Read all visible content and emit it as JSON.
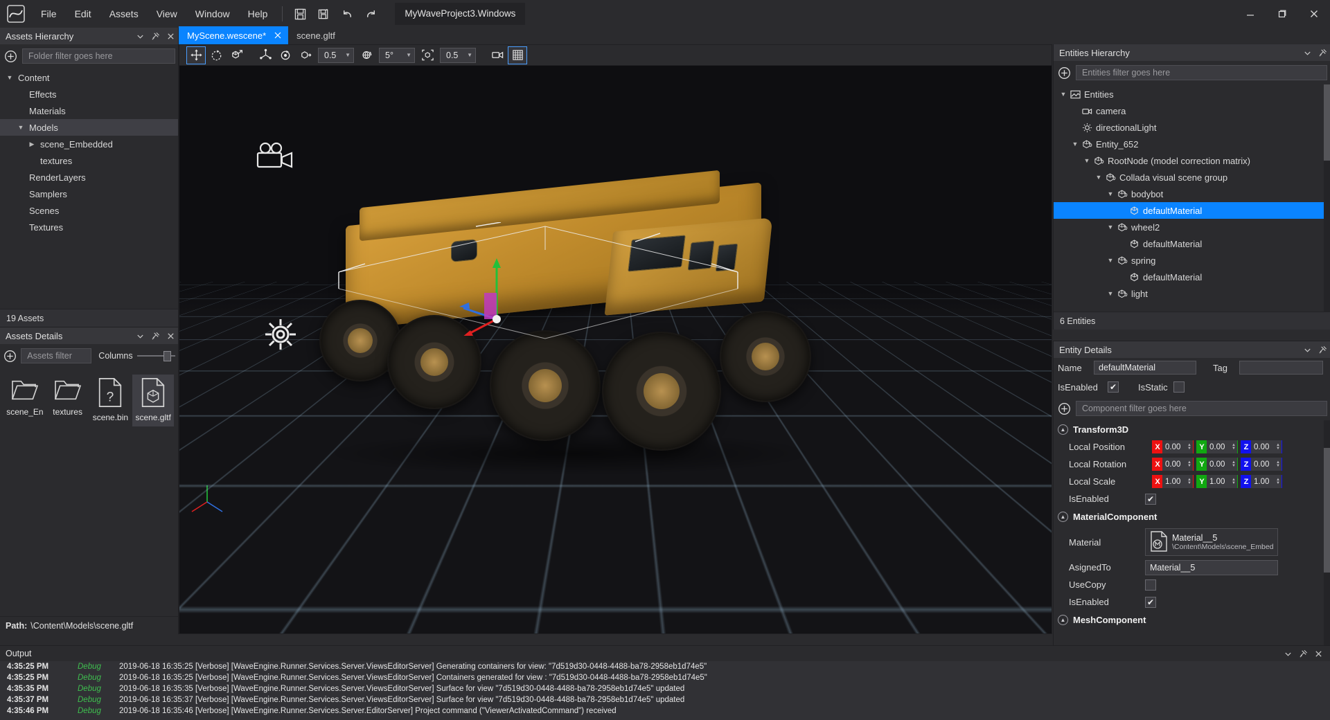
{
  "titlebar": {
    "logo_icon": "wave-engine-logo",
    "menus": [
      "File",
      "Edit",
      "Assets",
      "View",
      "Window",
      "Help"
    ],
    "icons": [
      {
        "name": "save-icon",
        "label": "Save"
      },
      {
        "name": "save-all-icon",
        "label": "Save All"
      },
      {
        "name": "undo-icon",
        "label": "Undo"
      },
      {
        "name": "redo-icon",
        "label": "Redo"
      }
    ],
    "project_name": "MyWaveProject3.Windows",
    "window_controls": [
      {
        "name": "minimize-button",
        "glyph": "—"
      },
      {
        "name": "maximize-button",
        "glyph": "❑"
      },
      {
        "name": "close-button",
        "glyph": "✕"
      }
    ]
  },
  "tabs": [
    {
      "label": "MyScene.wescene*",
      "active": true,
      "closable": true
    },
    {
      "label": "scene.gltf",
      "active": false,
      "closable": false
    }
  ],
  "assets_hierarchy": {
    "title": "Assets Hierarchy",
    "filter_placeholder": "Folder filter goes here",
    "add_icon": "plus-circle-icon",
    "header_icons": [
      "chevron-down-icon",
      "pin-icon",
      "close-icon"
    ],
    "tree": [
      {
        "label": "Content",
        "depth": 0,
        "caret": "down",
        "selected": false
      },
      {
        "label": "Effects",
        "depth": 1,
        "caret": "none",
        "selected": false
      },
      {
        "label": "Materials",
        "depth": 1,
        "caret": "none",
        "selected": false
      },
      {
        "label": "Models",
        "depth": 1,
        "caret": "down",
        "selected": true
      },
      {
        "label": "scene_Embedded",
        "depth": 2,
        "caret": "right",
        "selected": false
      },
      {
        "label": "textures",
        "depth": 2,
        "caret": "none",
        "selected": false
      },
      {
        "label": "RenderLayers",
        "depth": 1,
        "caret": "none",
        "selected": false
      },
      {
        "label": "Samplers",
        "depth": 1,
        "caret": "none",
        "selected": false
      },
      {
        "label": "Scenes",
        "depth": 1,
        "caret": "none",
        "selected": false
      },
      {
        "label": "Textures",
        "depth": 1,
        "caret": "none",
        "selected": false
      }
    ],
    "status": "19 Assets"
  },
  "assets_details": {
    "title": "Assets Details",
    "header_icons": [
      "chevron-down-icon",
      "pin-icon",
      "close-icon"
    ],
    "filter_placeholder": "Assets filter",
    "columns_label": "Columns",
    "add_icon": "plus-circle-icon",
    "assets": [
      {
        "name": "scene_En",
        "icon": "folder-icon",
        "selected": false
      },
      {
        "name": "textures",
        "icon": "folder-icon",
        "selected": false
      },
      {
        "name": "scene.bin",
        "icon": "unknown-file-icon",
        "selected": false
      },
      {
        "name": "scene.gltf",
        "icon": "model-file-icon",
        "selected": true
      }
    ],
    "path_label": "Path:",
    "path_value": "\\Content\\Models\\scene.gltf"
  },
  "viewport_toolbar": {
    "buttons": [
      {
        "name": "translate-tool-button",
        "icon": "move-arrows-icon",
        "active": true
      },
      {
        "name": "rotate-tool-button",
        "icon": "rotate-dashed-icon",
        "active": false
      },
      {
        "name": "scale-tool-button",
        "icon": "scale-cube-icon",
        "active": false
      },
      {
        "name": "snap-translate-button",
        "icon": "snap-axes-icon",
        "active": false
      },
      {
        "name": "snap-rotate-button",
        "icon": "snap-rotate-icon",
        "active": false
      },
      {
        "name": "snap-scale-button",
        "icon": "snap-scale-icon",
        "active": false
      }
    ],
    "translate_snap": "0.5",
    "rotate_snap_icon": "globe-rotate-icon",
    "rotate_snap": "5°",
    "scale_snap_icon": "bounds-scale-icon",
    "scale_snap": "0.5",
    "camera_button": {
      "name": "camera-preview-button",
      "icon": "video-camera-icon",
      "active": false
    },
    "grid_button": {
      "name": "grid-toggle-button",
      "icon": "grid-icon",
      "active": true
    }
  },
  "viewport": {
    "camera_gizmo_icon": "scene-camera-icon",
    "gear_gizmo_icon": "gear-icon",
    "transform_gizmo": "translate-gizmo",
    "axis_colors": {
      "x": "#e02020",
      "y": "#22c03a",
      "z": "#2f6fe0"
    }
  },
  "entities_hierarchy": {
    "title": "Entities Hierarchy",
    "header_icons": [
      "chevron-down-icon",
      "pin-icon"
    ],
    "filter_placeholder": "Entities filter goes here",
    "add_icon": "plus-circle-icon",
    "tree": [
      {
        "label": "Entities",
        "depth": 0,
        "caret": "down",
        "icon": "scene-image-icon",
        "selected": false
      },
      {
        "label": "camera",
        "depth": 1,
        "caret": "none",
        "icon": "camera-icon",
        "selected": false
      },
      {
        "label": "directionalLight",
        "depth": 1,
        "caret": "none",
        "icon": "light-icon",
        "selected": false
      },
      {
        "label": "Entity_652",
        "depth": 1,
        "caret": "down",
        "icon": "entity-cube-icon",
        "selected": false
      },
      {
        "label": "RootNode (model correction matrix)",
        "depth": 2,
        "caret": "down",
        "icon": "entity-cube-icon",
        "selected": false
      },
      {
        "label": "Collada visual scene group",
        "depth": 3,
        "caret": "down",
        "icon": "entity-cube-icon",
        "selected": false
      },
      {
        "label": "bodybot",
        "depth": 4,
        "caret": "down",
        "icon": "entity-cube-icon",
        "selected": false
      },
      {
        "label": "defaultMaterial",
        "depth": 5,
        "caret": "none",
        "icon": "mesh-cube-icon",
        "selected": true
      },
      {
        "label": "wheel2",
        "depth": 4,
        "caret": "down",
        "icon": "entity-cube-icon",
        "selected": false
      },
      {
        "label": "defaultMaterial",
        "depth": 5,
        "caret": "none",
        "icon": "mesh-cube-icon",
        "selected": false
      },
      {
        "label": "spring",
        "depth": 4,
        "caret": "down",
        "icon": "entity-cube-icon",
        "selected": false
      },
      {
        "label": "defaultMaterial",
        "depth": 5,
        "caret": "none",
        "icon": "mesh-cube-icon",
        "selected": false
      },
      {
        "label": "light",
        "depth": 4,
        "caret": "down",
        "icon": "entity-cube-icon",
        "selected": false
      }
    ],
    "status": "6 Entities"
  },
  "entity_details": {
    "title": "Entity Details",
    "header_icons": [
      "chevron-down-icon",
      "pin-icon"
    ],
    "name_label": "Name",
    "name_value": "defaultMaterial",
    "tag_label": "Tag",
    "tag_value": "",
    "isenabled_label": "IsEnabled",
    "isenabled_checked": true,
    "isstatic_label": "IsStatic",
    "isstatic_checked": false,
    "component_filter_placeholder": "Component filter goes here",
    "add_icon": "plus-circle-icon",
    "transform": {
      "title": "Transform3D",
      "rows": [
        {
          "label": "Local Position",
          "x": "0.00",
          "y": "0.00",
          "z": "0.00"
        },
        {
          "label": "Local Rotation",
          "x": "0.00",
          "y": "0.00",
          "z": "0.00"
        },
        {
          "label": "Local Scale",
          "x": "1.00",
          "y": "1.00",
          "z": "1.00"
        }
      ],
      "isenabled_label": "IsEnabled",
      "isenabled_checked": true
    },
    "material_component": {
      "title": "MaterialComponent",
      "material_label": "Material",
      "material_name": "Material__5",
      "material_path": "\\Content\\Models\\scene_Embed",
      "material_icon": "material-file-icon",
      "assigned_label": "AsignedTo",
      "assigned_value": "Material__5",
      "usecopy_label": "UseCopy",
      "usecopy_checked": false,
      "isenabled_label": "IsEnabled",
      "isenabled_checked": true
    },
    "mesh_component": {
      "title": "MeshComponent"
    }
  },
  "output": {
    "title": "Output",
    "header_icons": [
      "chevron-down-icon",
      "pin-icon",
      "close-icon"
    ],
    "rows": [
      {
        "time": "4:35:25 PM",
        "level": "Debug",
        "message": "2019-06-18 16:35:25 [Verbose] [WaveEngine.Runner.Services.Server.ViewsEditorServer] Generating containers for view: \"7d519d30-0448-4488-ba78-2958eb1d74e5\""
      },
      {
        "time": "4:35:25 PM",
        "level": "Debug",
        "message": "2019-06-18 16:35:25 [Verbose] [WaveEngine.Runner.Services.Server.ViewsEditorServer] Containers generated for view : \"7d519d30-0448-4488-ba78-2958eb1d74e5\""
      },
      {
        "time": "4:35:35 PM",
        "level": "Debug",
        "message": "2019-06-18 16:35:35 [Verbose] [WaveEngine.Runner.Services.Server.ViewsEditorServer] Surface for view \"7d519d30-0448-4488-ba78-2958eb1d74e5\" updated"
      },
      {
        "time": "4:35:37 PM",
        "level": "Debug",
        "message": "2019-06-18 16:35:37 [Verbose] [WaveEngine.Runner.Services.Server.ViewsEditorServer] Surface for view \"7d519d30-0448-4488-ba78-2958eb1d74e5\" updated"
      },
      {
        "time": "4:35:46 PM",
        "level": "Debug",
        "message": "2019-06-18 16:35:46 [Verbose] [WaveEngine.Runner.Services.Server.EditorServer] Project command (\"ViewerActivatedCommand\") received"
      }
    ]
  },
  "colors": {
    "accent": "#0a84ff",
    "panel_bg": "#2b2b2e",
    "panel_head": "#37373b",
    "axis_x": "#ee1111",
    "axis_y": "#11a811",
    "axis_z": "#1111ee",
    "debug_green": "#3fbf4f"
  }
}
